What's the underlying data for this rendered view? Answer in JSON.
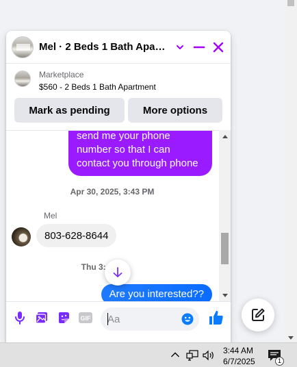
{
  "header": {
    "title": "Mel · 2 Beds 1 Bath Apart...",
    "accent_color": "#a000ff"
  },
  "listing": {
    "category": "Marketplace",
    "title": "$560 - 2 Beds 1 Bath Apartment",
    "mark_pending_label": "Mark as pending",
    "more_options_label": "More options"
  },
  "messages": {
    "outgoing_1": "send me your phone number so that I can contact you through phone",
    "timestamp_1": "Apr 30, 2025, 3:43 PM",
    "sender_name": "Mel",
    "incoming_1": "803-628-8644",
    "timestamp_2": "Thu 3:4_ M",
    "outgoing_2": "Are you interested??",
    "outgoing_colors": [
      "#9a1bff",
      "#0a6cff"
    ]
  },
  "composer": {
    "placeholder": "Aa"
  },
  "taskbar": {
    "time": "3:44 AM",
    "date": "6/7/2025",
    "notification_count": "1"
  }
}
